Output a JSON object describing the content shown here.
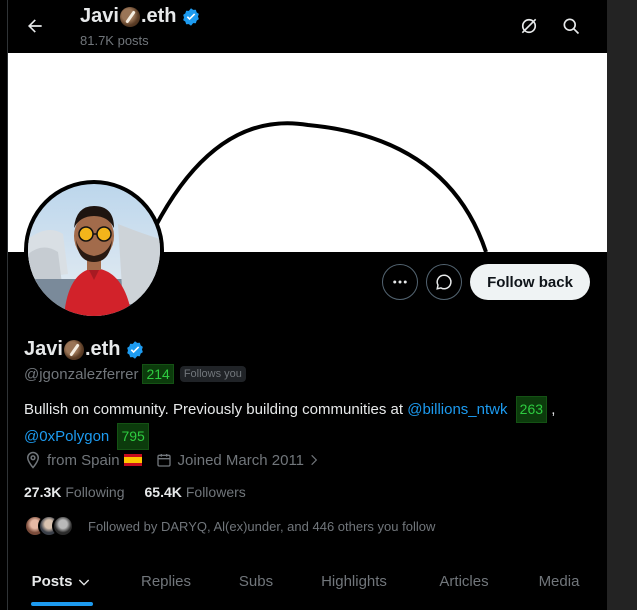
{
  "header": {
    "name_prefix": "Javi",
    "name_suffix": ".eth",
    "posts_count": "81.7K posts"
  },
  "profile": {
    "name_prefix": "Javi",
    "name_suffix": ".eth",
    "handle": "@jgonzalezferrer",
    "handle_badge": "214",
    "follows_you": "Follows you",
    "bio_text": "Bullish on community. Previously building communities at ",
    "bio_link1": "@billions_ntwk",
    "bio_link1_badge": "263",
    "bio_comma": " ,",
    "bio_link2": "@0xPolygon",
    "bio_link2_badge": "795",
    "location": "from Spain",
    "joined": "Joined March 2011",
    "following_count": "27.3K",
    "following_label": "Following",
    "followers_count": "65.4K",
    "followers_label": "Followers",
    "followed_by": "Followed by DARYQ, Al(ex)under, and 446 others you follow"
  },
  "actions": {
    "follow_back": "Follow back"
  },
  "tabs": [
    {
      "label": "Posts"
    },
    {
      "label": "Replies"
    },
    {
      "label": "Subs"
    },
    {
      "label": "Highlights"
    },
    {
      "label": "Articles"
    },
    {
      "label": "Media"
    }
  ],
  "icons": {
    "back": "arrow-left-icon",
    "grok": "grok-icon",
    "search": "search-icon",
    "more": "more-icon",
    "message": "message-icon"
  },
  "colors": {
    "accent": "#1d9bf0",
    "badge_green": "#2ecc40"
  }
}
